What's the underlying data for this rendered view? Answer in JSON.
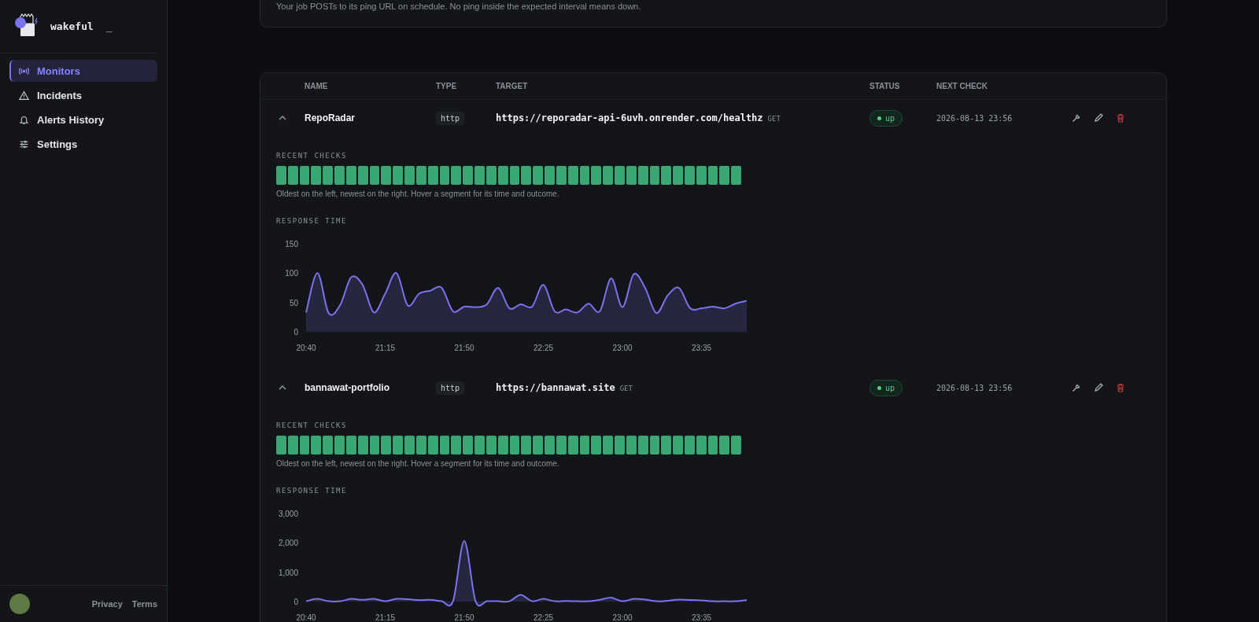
{
  "sidebar": {
    "brand": "wakeful",
    "cursor": "_",
    "nav": [
      {
        "label": "Monitors",
        "kind": "signal",
        "selected": true
      },
      {
        "label": "Incidents",
        "kind": "warning",
        "selected": false
      },
      {
        "label": "Alerts History",
        "kind": "bell",
        "selected": false
      },
      {
        "label": "Settings",
        "kind": "sliders",
        "selected": false
      }
    ],
    "footer_links": [
      "Privacy",
      "Terms"
    ]
  },
  "info_card": {
    "text": "Your job POSTs to its ping URL on schedule. No ping inside the expected interval means down."
  },
  "table": {
    "columns": [
      "NAME",
      "TYPE",
      "TARGET",
      "STATUS",
      "NEXT CHECK"
    ],
    "rows": [
      {
        "name": "RepoRadar",
        "type": "http",
        "target": "https://reporadar-api-6uvh.onrender.com/healthz",
        "method": "GET",
        "status": "up",
        "next_check": "2026-08-13 23:56",
        "expanded": true,
        "recent_checks_label": "RECENT CHECKS",
        "checks": [
          {
            "ok": true
          },
          {
            "ok": true
          },
          {
            "ok": true
          },
          {
            "ok": true
          },
          {
            "ok": true
          },
          {
            "ok": true
          },
          {
            "ok": true
          },
          {
            "ok": true
          },
          {
            "ok": true
          },
          {
            "ok": true
          },
          {
            "ok": true
          },
          {
            "ok": true
          },
          {
            "ok": true
          },
          {
            "ok": true
          },
          {
            "ok": true
          },
          {
            "ok": true
          },
          {
            "ok": true
          },
          {
            "ok": true
          },
          {
            "ok": true
          },
          {
            "ok": true
          },
          {
            "ok": true
          },
          {
            "ok": true
          },
          {
            "ok": true
          },
          {
            "ok": true
          },
          {
            "ok": true
          },
          {
            "ok": true
          },
          {
            "ok": true
          },
          {
            "ok": true
          },
          {
            "ok": true
          },
          {
            "ok": true
          },
          {
            "ok": true
          },
          {
            "ok": true
          },
          {
            "ok": true
          },
          {
            "ok": true
          },
          {
            "ok": true
          },
          {
            "ok": true
          },
          {
            "ok": true
          },
          {
            "ok": true
          },
          {
            "ok": true
          },
          {
            "ok": true
          }
        ],
        "hint": "Oldest on the left, newest on the right. Hover a segment for its time and outcome.",
        "response_label": "RESPONSE TIME",
        "chart_data": {
          "type": "area",
          "categories": [
            "20:40",
            null,
            null,
            null,
            null,
            null,
            null,
            "21:15",
            null,
            null,
            null,
            null,
            null,
            null,
            "21:50",
            null,
            null,
            null,
            null,
            null,
            null,
            "22:25",
            null,
            null,
            null,
            null,
            null,
            null,
            "23:00",
            null,
            null,
            null,
            null,
            null,
            null,
            "23:35",
            null,
            null,
            null,
            null
          ],
          "series": [
            {
              "color": "#7b72f0",
              "values": [
                33,
                100,
                32,
                45,
                93,
                80,
                33,
                65,
                100,
                45,
                65,
                70,
                75,
                35,
                43,
                42,
                47,
                75,
                40,
                47,
                43,
                80,
                35,
                38,
                33,
                48,
                35,
                91,
                42,
                98,
                75,
                32,
                62,
                75,
                40,
                40,
                43,
                40,
                48,
                53
              ]
            }
          ],
          "ylim": [
            0,
            150
          ],
          "yticks": [
            0,
            50,
            100,
            {
              "value": 150,
              "label": "150"
            }
          ]
        }
      },
      {
        "name": "bannawat-portfolio",
        "type": "http",
        "target": "https://bannawat.site",
        "method": "GET",
        "status": "up",
        "next_check": "2026-08-13 23:56",
        "expanded": true,
        "recent_checks_label": "RECENT CHECKS",
        "checks": [
          {
            "ok": true
          },
          {
            "ok": true
          },
          {
            "ok": true
          },
          {
            "ok": true
          },
          {
            "ok": true
          },
          {
            "ok": true
          },
          {
            "ok": true
          },
          {
            "ok": true
          },
          {
            "ok": true
          },
          {
            "ok": true
          },
          {
            "ok": true
          },
          {
            "ok": true
          },
          {
            "ok": true
          },
          {
            "ok": true
          },
          {
            "ok": true
          },
          {
            "ok": true
          },
          {
            "ok": true
          },
          {
            "ok": true
          },
          {
            "ok": true
          },
          {
            "ok": true
          },
          {
            "ok": true
          },
          {
            "ok": true
          },
          {
            "ok": true
          },
          {
            "ok": true
          },
          {
            "ok": true
          },
          {
            "ok": true
          },
          {
            "ok": true
          },
          {
            "ok": true
          },
          {
            "ok": true
          },
          {
            "ok": true
          },
          {
            "ok": true
          },
          {
            "ok": true
          },
          {
            "ok": true
          },
          {
            "ok": true
          },
          {
            "ok": true
          },
          {
            "ok": true
          },
          {
            "ok": true
          },
          {
            "ok": true
          },
          {
            "ok": true
          },
          {
            "ok": true
          }
        ],
        "hint": "Oldest on the left, newest on the right. Hover a segment for its time and outcome.",
        "response_label": "RESPONSE TIME",
        "chart_data": {
          "type": "area",
          "categories": [
            "20:40",
            null,
            null,
            null,
            null,
            null,
            null,
            "21:15",
            null,
            null,
            null,
            null,
            null,
            null,
            "21:50",
            null,
            null,
            null,
            null,
            null,
            null,
            "22:25",
            null,
            null,
            null,
            null,
            null,
            null,
            "23:00",
            null,
            null,
            null,
            null,
            null,
            null,
            "23:35",
            null,
            null,
            null,
            null
          ],
          "series": [
            {
              "color": "#7b72f0",
              "values": [
                10,
                90,
                10,
                10,
                90,
                60,
                90,
                10,
                90,
                80,
                50,
                60,
                10,
                10,
                2060,
                10,
                10,
                10,
                10,
                230,
                10,
                90,
                10,
                20,
                10,
                10,
                60,
                130,
                10,
                90,
                70,
                10,
                30,
                70,
                50,
                40,
                10,
                10,
                10,
                50
              ]
            }
          ],
          "ylim": [
            0,
            3000
          ],
          "yticks": [
            {
              "value": 0,
              "label": "0"
            },
            {
              "value": 1000,
              "label": "1,000"
            },
            {
              "value": 2000,
              "label": "2,000"
            },
            {
              "value": 3000,
              "label": "3,000"
            }
          ]
        }
      }
    ]
  }
}
